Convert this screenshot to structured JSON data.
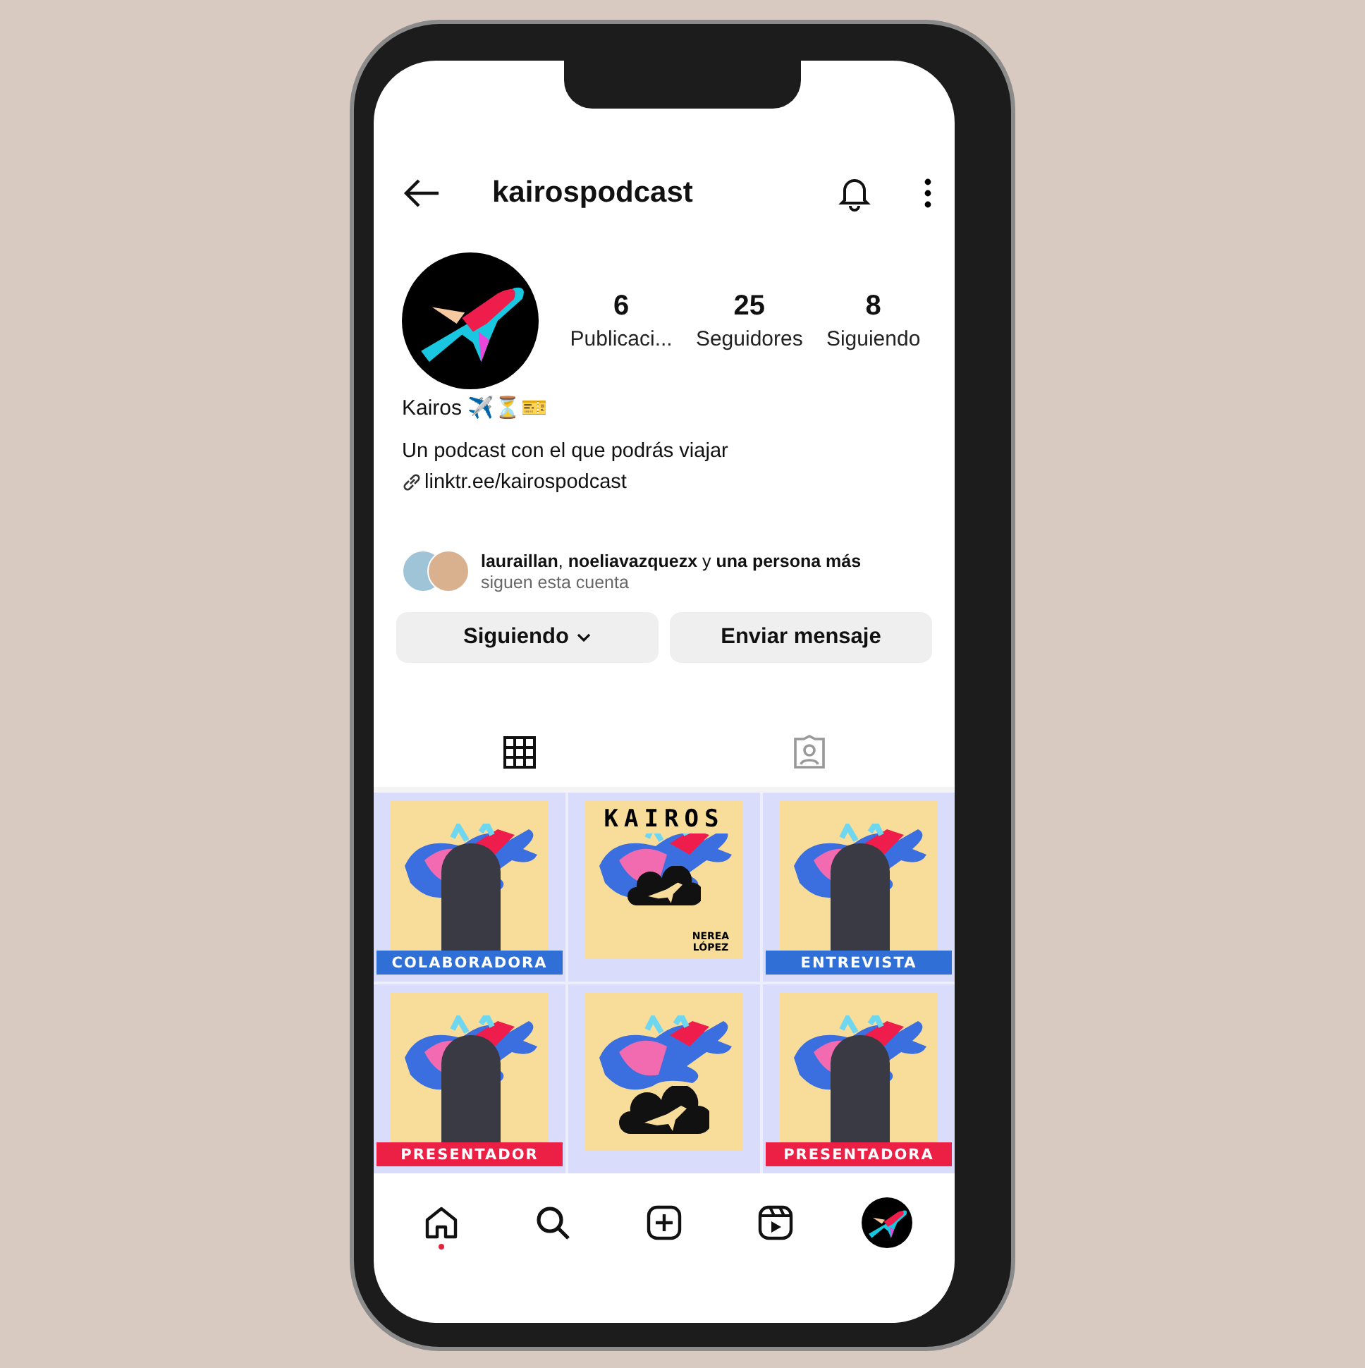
{
  "header": {
    "username": "kairospodcast"
  },
  "profile": {
    "stats": [
      {
        "value": "6",
        "label": "Publicaci..."
      },
      {
        "value": "25",
        "label": "Seguidores"
      },
      {
        "value": "8",
        "label": "Siguiendo"
      }
    ],
    "name": "Kairos ✈️⏳🎫",
    "bio": "Un podcast con el que podrás viajar",
    "link": "linktr.ee/kairospodcast",
    "followed_by": "**lauraillan**, **noeliavazquezx** y **una persona más**",
    "followed_by_note": "siguen esta cuenta"
  },
  "actions": [
    {
      "label": "Siguiendo",
      "dropdown": true
    },
    {
      "label": "Enviar mensaje",
      "dropdown": false
    }
  ],
  "tabs": [
    {
      "kind": "grid",
      "selected": true
    },
    {
      "kind": "tagged",
      "selected": false
    }
  ],
  "posts": [
    {
      "kind": "portrait",
      "banner": "COLABORADORA",
      "color": "#2f6fd6"
    },
    {
      "kind": "cover",
      "title": "KAIROS",
      "credit": "NEREA LÓPEZ"
    },
    {
      "kind": "portrait",
      "banner": "ENTREVISTA",
      "color": "#2f6fd6"
    },
    {
      "kind": "portrait",
      "banner": "PRESENTADOR",
      "color": "#ec1f45"
    },
    {
      "kind": "logo"
    },
    {
      "kind": "portrait",
      "banner": "PRESENTADORA",
      "color": "#ec1f45"
    }
  ],
  "nav": [
    {
      "kind": "home",
      "notification": true
    },
    {
      "kind": "search"
    },
    {
      "kind": "add"
    },
    {
      "kind": "reels"
    },
    {
      "kind": "profile"
    }
  ]
}
